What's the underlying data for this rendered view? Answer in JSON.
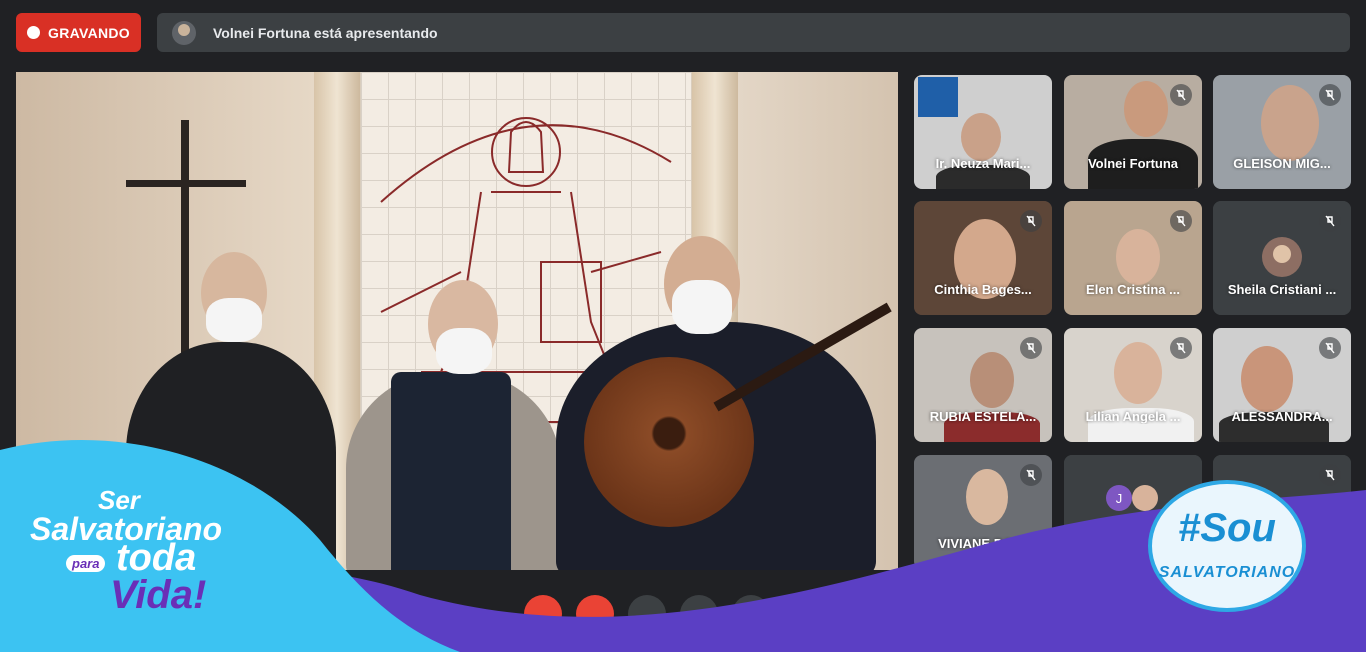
{
  "recording": {
    "label": "GRAVANDO"
  },
  "presenting": {
    "text": "Volnei Fortuna está apresentando"
  },
  "participants": [
    {
      "name": "Ir. Neuza Mari...",
      "muted": false,
      "bg": "#cfcfcf"
    },
    {
      "name": "Volnei Fortuna",
      "muted": true,
      "bg": "#b8ada1"
    },
    {
      "name": "GLEISON MIG...",
      "muted": true,
      "bg": "#9aa0a6"
    },
    {
      "name": "Cinthia Bages...",
      "muted": true,
      "bg": "#5d4638"
    },
    {
      "name": "Elen Cristina ...",
      "muted": true,
      "bg": "#b9a58f"
    },
    {
      "name": "Sheila Cristiani ...",
      "muted": true,
      "bg": "#3c4043"
    },
    {
      "name": "RUBIA ESTELA...",
      "muted": true,
      "bg": "#c7c2bc"
    },
    {
      "name": "Lilian Angela ...",
      "muted": true,
      "bg": "#d8d3cc"
    },
    {
      "name": "ALESSANDRA...",
      "muted": true,
      "bg": "#cfcfcf"
    },
    {
      "name": "VIVIANE DA SI",
      "muted": true,
      "bg": "#6b6e73"
    },
    {
      "name": "",
      "muted": false,
      "bg": "#3c4043"
    },
    {
      "name": "",
      "muted": true,
      "bg": "#3c4043"
    }
  ],
  "overlay": {
    "left_ser": "Ser",
    "left_salvatoriano": "Salvatoriano",
    "left_para": "para",
    "left_toda": "toda",
    "left_vida": "Vida!",
    "right_sou": "#Sou",
    "right_salvatoriano": "SALVATORIANO"
  },
  "avatar_initial": "J",
  "colors": {
    "record_red": "#d93025",
    "panel": "#3c4043",
    "background": "#202124",
    "wave_blue": "#3cc3f2",
    "wave_purple": "#6a2fb7"
  }
}
